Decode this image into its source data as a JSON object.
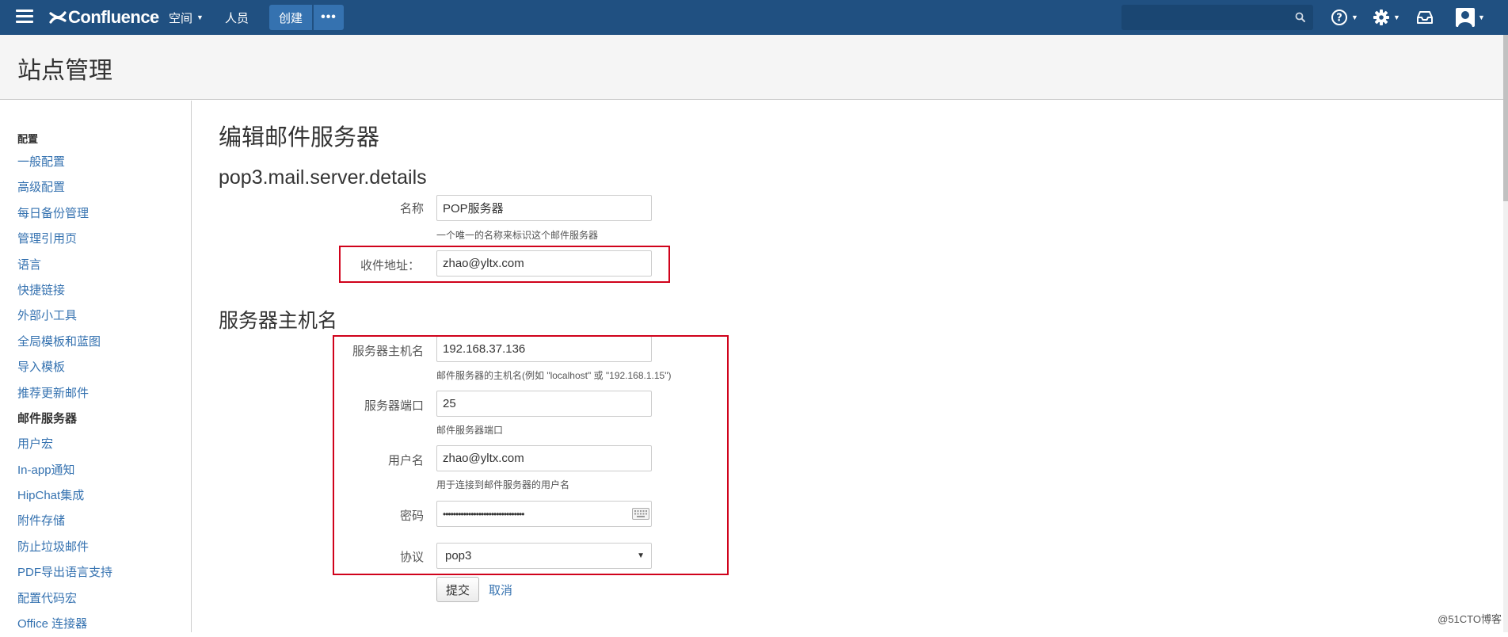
{
  "header": {
    "logo_text": "Confluence",
    "nav": {
      "spaces_label": "空间",
      "people_label": "人员",
      "create_label": "创建",
      "more_label": "•••"
    },
    "search": {
      "placeholder": ""
    },
    "icons": [
      "help-icon",
      "gear-icon",
      "inbox-icon",
      "user-icon"
    ]
  },
  "page": {
    "title": "站点管理"
  },
  "sidebar": {
    "heading": "配置",
    "items": [
      {
        "label": "一般配置"
      },
      {
        "label": "高级配置"
      },
      {
        "label": "每日备份管理"
      },
      {
        "label": "管理引用页"
      },
      {
        "label": "语言"
      },
      {
        "label": "快捷链接"
      },
      {
        "label": "外部小工具"
      },
      {
        "label": "全局模板和蓝图"
      },
      {
        "label": "导入模板"
      },
      {
        "label": "推荐更新邮件"
      },
      {
        "label": "邮件服务器"
      },
      {
        "label": "用户宏"
      },
      {
        "label": "In-app通知"
      },
      {
        "label": "HipChat集成"
      },
      {
        "label": "附件存储"
      },
      {
        "label": "防止垃圾邮件"
      },
      {
        "label": "PDF导出语言支持"
      },
      {
        "label": "配置代码宏"
      },
      {
        "label": "Office 连接器"
      }
    ],
    "active_item": "邮件服务器"
  },
  "main": {
    "title": "编辑邮件服务器",
    "details_section": {
      "title": "pop3.mail.server.details",
      "name": {
        "label": "名称",
        "value": "POP服务器",
        "help": "一个唯一的名称来标识这个邮件服务器"
      },
      "receive_address": {
        "label": "收件地址：",
        "value": "zhao@yltx.com"
      }
    },
    "host_section": {
      "title": "服务器主机名",
      "hostname": {
        "label": "服务器主机名",
        "value": "192.168.37.136",
        "help": "邮件服务器的主机名(例如 \"localhost\" 或 \"192.168.1.15\")"
      },
      "port": {
        "label": "服务器端口",
        "value": "25",
        "help": "邮件服务器端口"
      },
      "username": {
        "label": "用户名",
        "value": "zhao@yltx.com",
        "help": "用于连接到邮件服务器的用户名"
      },
      "password": {
        "label": "密码",
        "value": "••••••••••••••••••••••••••••••••"
      },
      "protocol": {
        "label": "协议",
        "value": "pop3"
      }
    },
    "actions": {
      "submit_label": "提交",
      "cancel_label": "取消"
    }
  },
  "watermark": "@51CTO博客",
  "colors": {
    "header_bg": "#205081",
    "create_btn": "#3572b0",
    "link": "#3572b0",
    "highlight": "#d0021b"
  }
}
